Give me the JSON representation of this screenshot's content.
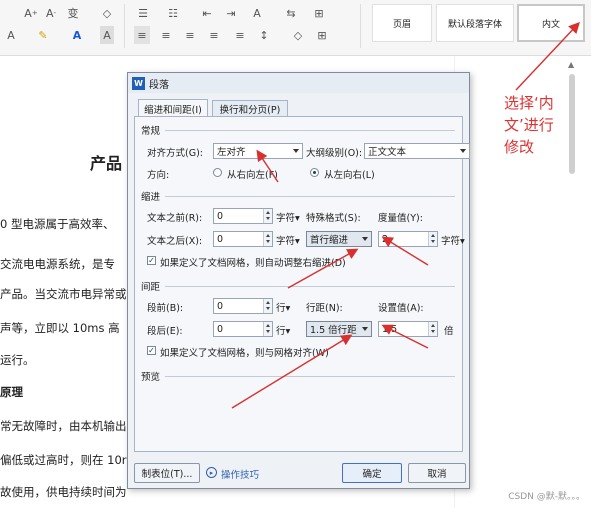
{
  "ribbon": {
    "tools_row1": [
      "A⁺",
      "A⁻",
      "wén",
      "◇",
      "•≡",
      "1≡",
      "⇤",
      "⇥",
      "A͎",
      "⇆",
      "⊞",
      "ᵖ"
    ],
    "tools_row2": [
      "A",
      "ℓ",
      "A",
      "A",
      "≡",
      "≡",
      "≡",
      "≡",
      "≡",
      "◇",
      "⊞"
    ],
    "styles": [
      "页眉",
      "默认段落字体",
      "内文"
    ],
    "accent_red": "#d8302f"
  },
  "document": {
    "heading": "产品",
    "lines": [
      "0 型电源属于高效率、",
      "交流电电源系统，是专",
      "产品。当交流市电异常或",
      "声等，立即以 10ms 高",
      "运行。",
      "原理",
      "常无故障时，由本机输出",
      "偏低或过高时，则在 10r",
      "故使用，供电持续时间为"
    ]
  },
  "annotation": {
    "text": "选择‘内文’进行修改",
    "lines": [
      "选择‘内",
      "文’进行",
      "修改"
    ]
  },
  "watermark": "CSDN @默-默。。。",
  "dialog": {
    "title": "段落",
    "tabs": [
      "缩进和间距(I)",
      "换行和分页(P)"
    ],
    "sections": {
      "general": "常规",
      "indent": "缩进",
      "spacing": "间距",
      "preview": "预览"
    },
    "general": {
      "alignment_label": "对齐方式(G):",
      "alignment_value": "左对齐",
      "outline_label": "大纲级别(O):",
      "outline_value": "正文文本",
      "direction_label": "方向:",
      "rtl_label": "从右向左(F)",
      "ltr_label": "从左向右(L)"
    },
    "indent": {
      "before_label": "文本之前(R):",
      "before_value": "0",
      "after_label": "文本之后(X):",
      "after_value": "0",
      "unit": "字符▾",
      "special_label": "特殊格式(S):",
      "special_value": "首行缩进",
      "measure_label": "度量值(Y):",
      "measure_value": "2",
      "measure_unit": "字符▾",
      "grid_check": "如果定义了文档网格，则自动调整右缩进(D)"
    },
    "spacing": {
      "before_label": "段前(B):",
      "before_value": "0",
      "after_label": "段后(E):",
      "after_value": "0",
      "unit": "行▾",
      "line_label": "行距(N):",
      "line_value": "1.5 倍行距",
      "setting_label": "设置值(A):",
      "setting_value": "1.5",
      "setting_unit": "倍",
      "grid_check": "如果定义了文档网格，则与网格对齐(W)"
    },
    "buttons": {
      "tabs": "制表位(T)...",
      "tips": "操作技巧",
      "ok": "确定",
      "cancel": "取消"
    }
  }
}
